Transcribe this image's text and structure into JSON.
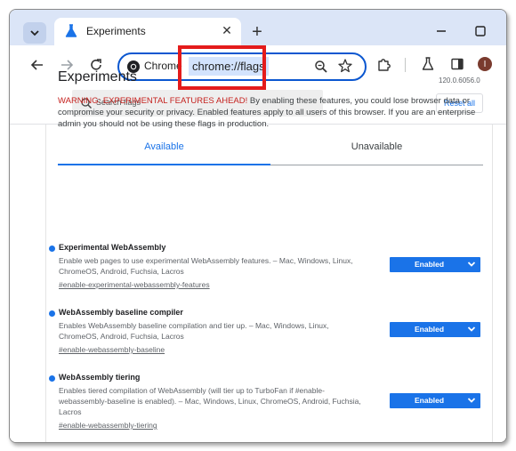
{
  "tabstrip": {
    "tab_title": "Experiments",
    "close_glyph": "✕",
    "new_tab_glyph": "+"
  },
  "toolbar": {
    "chip_label": "Chrome",
    "url": "chrome://flags",
    "avatar_initial": "I"
  },
  "content": {
    "search_placeholder": "Search flags",
    "reset_label": "Reset all",
    "title": "Experiments",
    "version": "120.0.6056.0",
    "warning_red": "WARNING: EXPERIMENTAL FEATURES AHEAD!",
    "warning_rest": " By enabling these features, you could lose browser data or compromise your security or privacy. Enabled features apply to all users of this browser. If you are an enterprise admin you should not be using these flags in production.",
    "tabs": [
      {
        "label": "Available"
      },
      {
        "label": "Unavailable"
      }
    ],
    "flags": [
      {
        "name": "Experimental WebAssembly",
        "description": "Enable web pages to use experimental WebAssembly features. – Mac, Windows, Linux, ChromeOS, Android, Fuchsia, Lacros",
        "link": "#enable-experimental-webassembly-features",
        "value": "Enabled"
      },
      {
        "name": "WebAssembly baseline compiler",
        "description": "Enables WebAssembly baseline compilation and tier up. – Mac, Windows, Linux, ChromeOS, Android, Fuchsia, Lacros",
        "link": "#enable-webassembly-baseline",
        "value": "Enabled"
      },
      {
        "name": "WebAssembly tiering",
        "description": "Enables tiered compilation of WebAssembly (will tier up to TurboFan if #enable-webassembly-baseline is enabled). – Mac, Windows, Linux, ChromeOS, Android, Fuchsia, Lacros",
        "link": "#enable-webassembly-tiering",
        "value": "Enabled"
      }
    ]
  },
  "colors": {
    "accent": "#1a73e8",
    "warning": "#c5221f",
    "highlight_box": "#e41b1b",
    "tabstrip": "#dbe5f7"
  },
  "icons": {
    "tab_search": "chevron-down-icon",
    "favicon": "flask-icon",
    "back": "back-arrow-icon",
    "forward": "forward-arrow-icon",
    "reload": "reload-icon",
    "chrome": "chrome-logo-icon",
    "zoom": "zoom-icon",
    "bookmark": "star-icon",
    "extensions": "puzzle-icon",
    "labs": "flask-icon",
    "side_panel": "side-panel-icon",
    "search": "search-icon"
  }
}
